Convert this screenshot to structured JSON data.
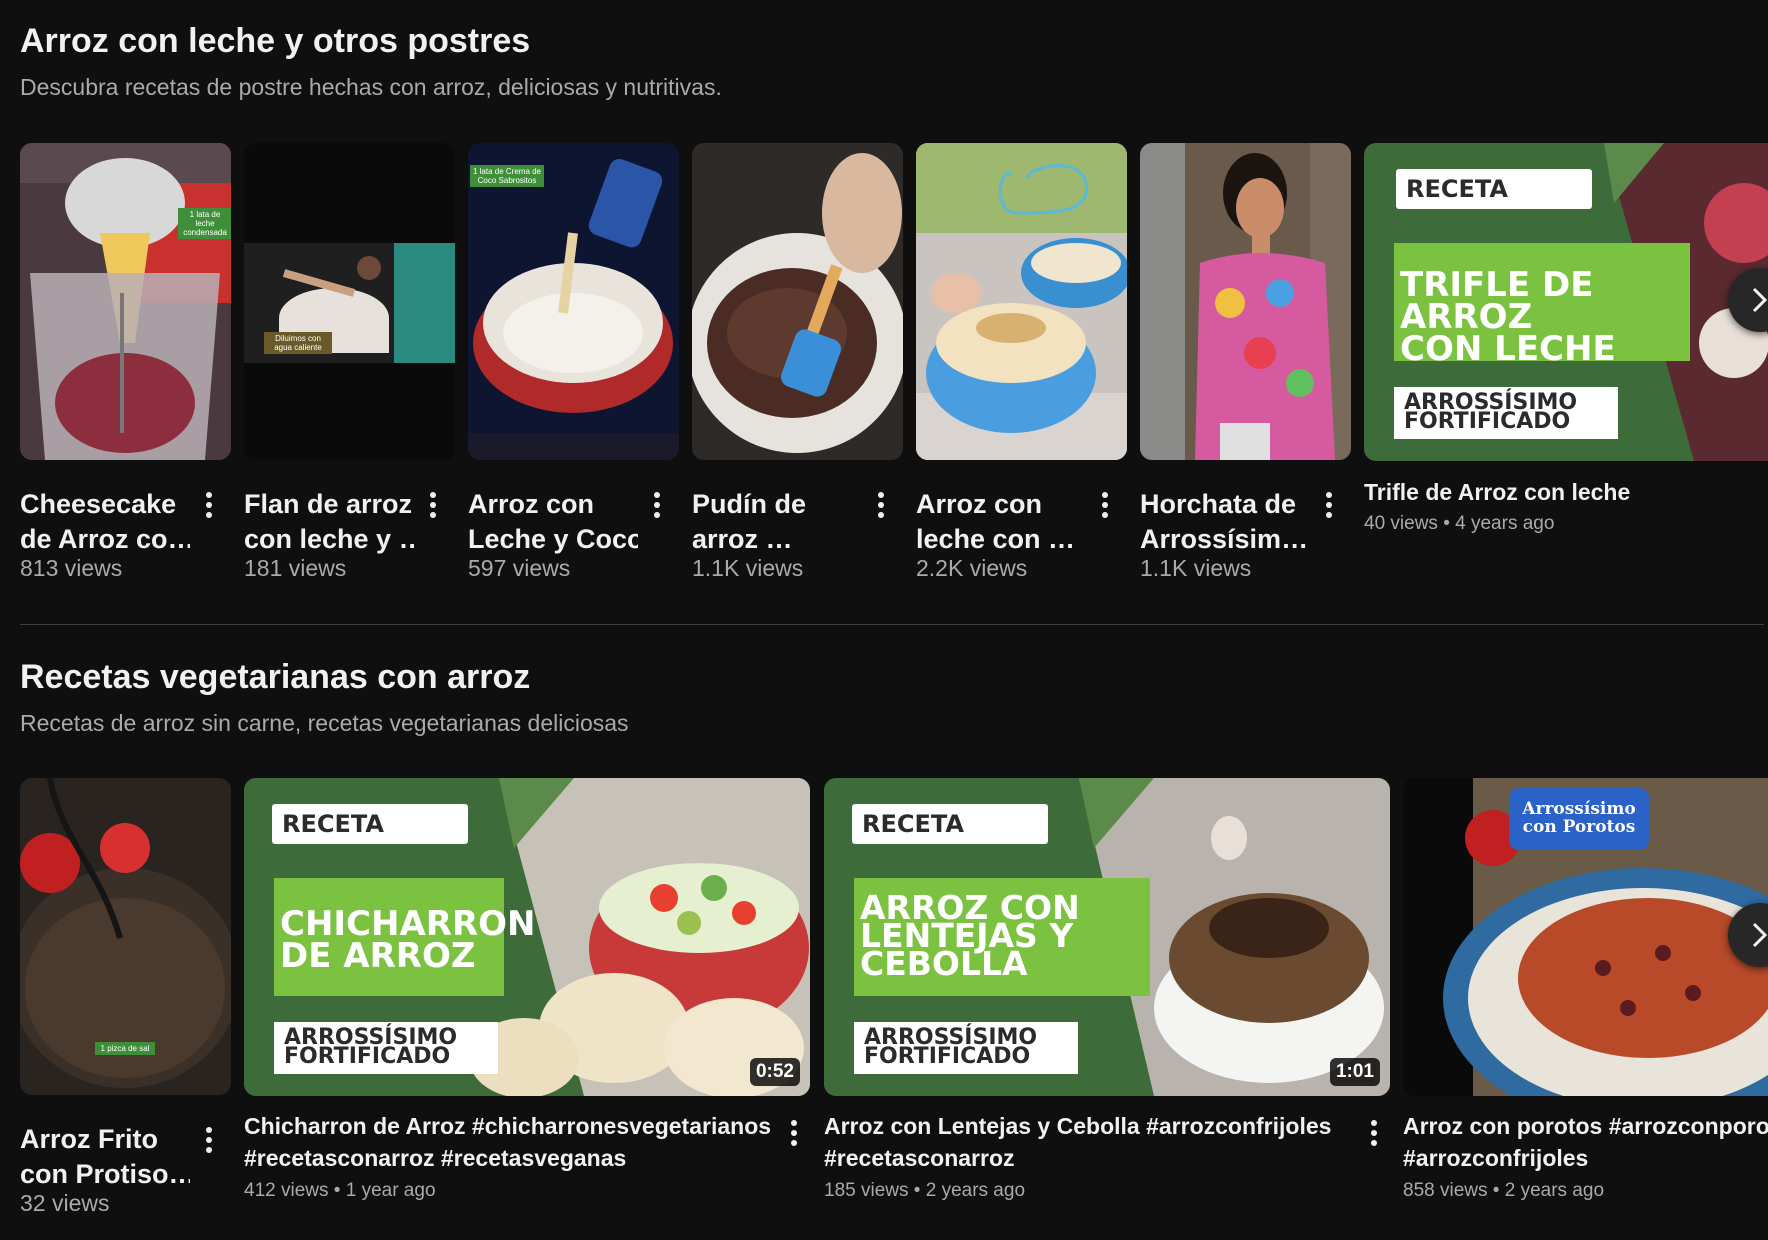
{
  "sections": [
    {
      "title": "Arroz con leche y otros postres",
      "subtitle": "Descubra recetas de postre hechas con arroz, deliciosas y nutritivas.",
      "shorts": [
        {
          "title_line1": "Cheesecake",
          "title_line2": "de Arroz co…",
          "views": "813 views",
          "overlay": "1 lata de leche condensada"
        },
        {
          "title_line1": "Flan de arroz",
          "title_line2": "con leche y …",
          "views": "181 views",
          "overlay": "Diluimos con agua caliente"
        },
        {
          "title_line1": "Arroz con",
          "title_line2": "Leche y Coco",
          "views": "597 views",
          "overlay": "1 lata de Crema de Coco Sabrositos"
        },
        {
          "title_line1": "Pudín de",
          "title_line2": "arroz …",
          "views": "1.1K views"
        },
        {
          "title_line1": "Arroz con",
          "title_line2": "leche con …",
          "views": "2.2K views"
        },
        {
          "title_line1": "Horchata de",
          "title_line2": "Arrossísim…",
          "views": "1.1K views"
        }
      ],
      "video": {
        "title": "Trifle de Arroz con leche",
        "views": "40 views",
        "age": "4 years ago",
        "thumb_tag": "RECETA",
        "thumb_title_1": "TRIFLE DE ARROZ",
        "thumb_title_2": "CON LECHE",
        "thumb_brand_1": "ARROSSÍSIMO",
        "thumb_brand_2": "FORTIFICADO"
      }
    },
    {
      "title": "Recetas vegetarianas con arroz",
      "subtitle": "Recetas de arroz sin carne, recetas vegetarianas deliciosas",
      "short": {
        "title_line1": "Arroz Frito",
        "title_line2": "con Protiso…",
        "views": "32 views",
        "overlay": "1 pizca de sal"
      },
      "videos": [
        {
          "title_line1": "Chicharron de Arroz #chicharronesvegetarianos",
          "title_line2": "#recetasconarroz #recetasveganas",
          "views": "412 views",
          "age": "1 year ago",
          "duration": "0:52",
          "thumb_tag": "RECETA",
          "thumb_title_1": "CHICHARRON",
          "thumb_title_2": "DE ARROZ",
          "thumb_brand_1": "ARROSSÍSIMO",
          "thumb_brand_2": "FORTIFICADO"
        },
        {
          "title_line1": "Arroz con Lentejas y Cebolla #arrozconfrijoles",
          "title_line2": "#recetasconarroz",
          "views": "185 views",
          "age": "2 years ago",
          "duration": "1:01",
          "thumb_tag": "RECETA",
          "thumb_title_1": "ARROZ CON",
          "thumb_title_2": "LENTEJAS Y",
          "thumb_title_3": "CEBOLLA",
          "thumb_brand_1": "ARROSSÍSIMO",
          "thumb_brand_2": "FORTIFICADO"
        },
        {
          "title_line1": "Arroz con porotos #arrozconporotos",
          "title_line2": "#arrozconfrijoles",
          "views": "858 views",
          "age": "2 years ago",
          "thumb_badge_1": "Arrossísimo",
          "thumb_badge_2": "con Porotos"
        }
      ]
    }
  ],
  "separator": "•",
  "icons": {
    "more": "more-vert-icon",
    "next": "chevron-right-icon"
  },
  "colors": {
    "background": "#0f0f0f",
    "text": "#f1f1f1",
    "secondary": "#aaaaaa",
    "brand_green": "#7cc241",
    "dark_green": "#3e6b3a"
  }
}
